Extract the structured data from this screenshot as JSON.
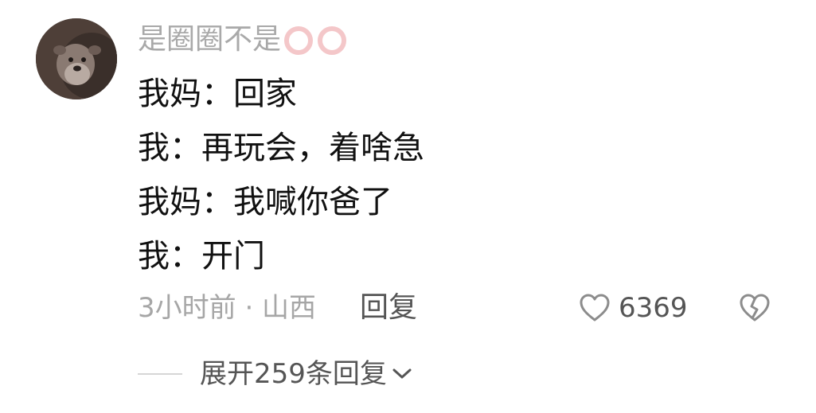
{
  "comment": {
    "username": "是圈圈不是",
    "lines": [
      "我妈：回家",
      "我：再玩会，着啥急",
      "我妈：我喊你爸了",
      "我：开门"
    ],
    "time_location": "3小时前 · 山西",
    "reply_label": "回复",
    "like_count": "6369",
    "expand_replies": "展开259条回复"
  },
  "colors": {
    "username": "#a9a9a9",
    "body_text": "#111111",
    "meta_text": "#a6a6a6",
    "action_text": "#555555",
    "ring_pink": "#f4c7c9"
  },
  "icons": {
    "rings": "pink-rings-icon",
    "like": "heart-outline-icon",
    "dislike": "broken-heart-icon",
    "expand": "chevron-down-icon"
  }
}
